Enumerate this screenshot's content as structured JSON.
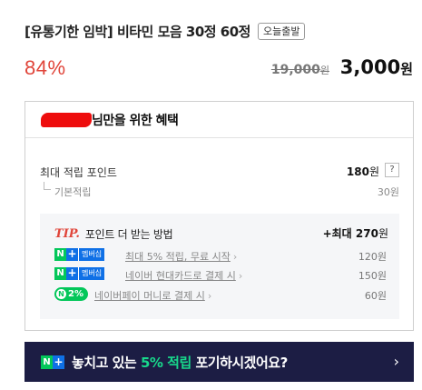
{
  "product": {
    "title": "[유통기한 임박] 비타민 모음 30정 60정",
    "today_badge": "오늘출발"
  },
  "price": {
    "discount": "84%",
    "original": "19,000",
    "original_unit": "원",
    "sale": "3,000",
    "sale_unit": "원"
  },
  "benefit": {
    "title_suffix": "님만을 위한 혜택",
    "max_points_label": "최대 적립 포인트",
    "max_points_value": "180",
    "max_points_unit": "원",
    "help_label": "?",
    "base_label": "기본적립",
    "base_value": "30원"
  },
  "tip": {
    "mark": "TIP.",
    "title": "포인트 더 받는 방법",
    "max_label": "+최대 270",
    "max_unit": "원",
    "items": [
      {
        "badge_n": "N",
        "badge_plus": "+",
        "badge_mem": "멤버십",
        "text": "최대 5% 적립, 무료 시작",
        "value": "120원"
      },
      {
        "badge_n": "N",
        "badge_plus": "+",
        "badge_mem": "멤버십",
        "text": "네이버 현대카드로 결제 시",
        "value": "150원"
      },
      {
        "badge_n": "N",
        "badge_pct": "2%",
        "text": "네이버페이 머니로 결제 시",
        "value": "60원"
      }
    ]
  },
  "banner": {
    "badge_n": "N",
    "badge_plus": "+",
    "text_before": "놓치고 있는 ",
    "text_accent": "5% 적립",
    "text_after": " 포기하시겠어요?",
    "chevron": "›"
  },
  "colors": {
    "discount": "#e0453a",
    "naver_green": "#03c75a",
    "membership_blue": "#0f70e6",
    "banner_bg": "#1c1d44",
    "banner_accent": "#18d98c"
  },
  "icons": {
    "tip_chevron": "chevron-right-icon",
    "banner_chevron": "chevron-right-icon"
  }
}
